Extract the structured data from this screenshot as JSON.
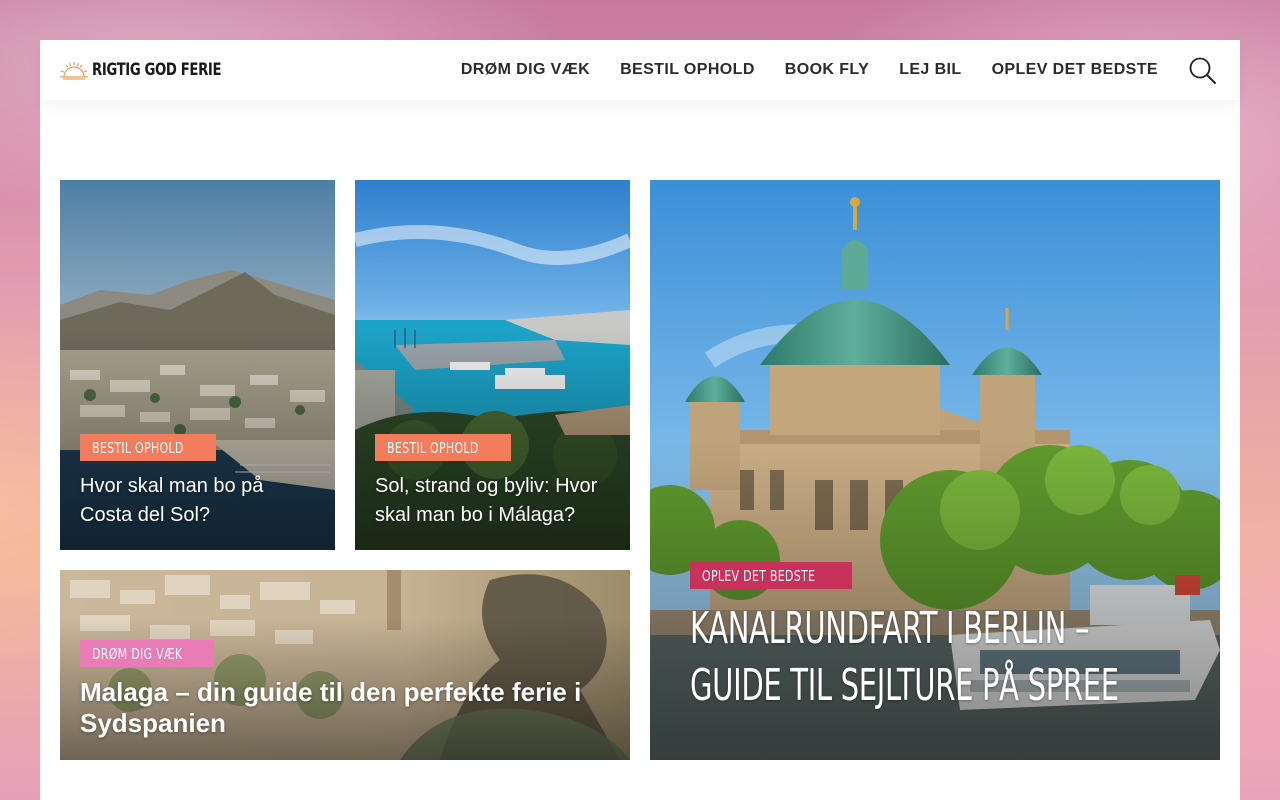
{
  "site": {
    "logo_text": "RIGTIG GOD FERIE"
  },
  "nav": {
    "items": [
      {
        "label": "DRØM DIG VÆK"
      },
      {
        "label": "BESTIL OPHOLD"
      },
      {
        "label": "BOOK FLY"
      },
      {
        "label": "LEJ BIL"
      },
      {
        "label": "OPLEV DET BEDSTE"
      }
    ],
    "search_icon": "search-icon"
  },
  "posts": [
    {
      "category": "BESTIL OPHOLD",
      "category_color": "#f27c5c",
      "title": "Hvor skal man bo på Costa del Sol?"
    },
    {
      "category": "BESTIL OPHOLD",
      "category_color": "#f27c5c",
      "title": "Sol, strand og byliv: Hvor skal man bo i Málaga?"
    },
    {
      "category": "DRØM DIG VÆK",
      "category_color": "#e97bb6",
      "title": "Malaga – din guide til den perfekte ferie i Sydspanien"
    },
    {
      "category": "OPLEV DET BEDSTE",
      "category_color": "#c8325a",
      "title": "KANALRUNDFART I BERLIN – GUIDE TIL SEJLTURE PÅ SPREE"
    }
  ]
}
